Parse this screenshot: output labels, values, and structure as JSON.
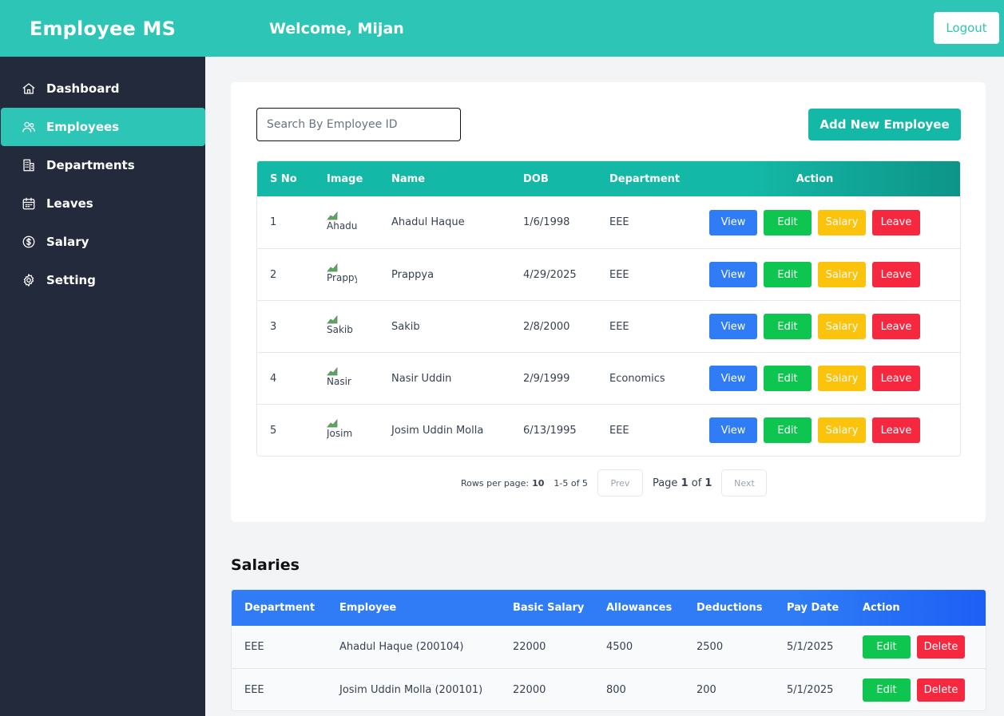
{
  "header": {
    "brand": "Employee MS",
    "welcome": "Welcome, Mijan",
    "logout_label": "Logout"
  },
  "sidebar": {
    "items": [
      {
        "label": "Dashboard",
        "icon": "home-icon"
      },
      {
        "label": "Employees",
        "icon": "users-icon",
        "active": true
      },
      {
        "label": "Departments",
        "icon": "building-icon"
      },
      {
        "label": "Leaves",
        "icon": "calendar-icon"
      },
      {
        "label": "Salary",
        "icon": "dollar-icon"
      },
      {
        "label": "Setting",
        "icon": "gear-icon"
      }
    ]
  },
  "employees": {
    "search_placeholder": "Search By Employee ID",
    "add_label": "Add New Employee",
    "columns": [
      "S No",
      "Image",
      "Name",
      "DOB",
      "Department",
      "Action"
    ],
    "actions": [
      "View",
      "Edit",
      "Salary",
      "Leave"
    ],
    "rows": [
      {
        "sno": "1",
        "img_alt": "Ahadul",
        "name": "Ahadul Haque",
        "dob": "1/6/1998",
        "dept": "EEE"
      },
      {
        "sno": "2",
        "img_alt": "Prappya",
        "name": "Prappya",
        "dob": "4/29/2025",
        "dept": "EEE"
      },
      {
        "sno": "3",
        "img_alt": "Sakib",
        "name": "Sakib",
        "dob": "2/8/2000",
        "dept": "EEE"
      },
      {
        "sno": "4",
        "img_alt": "Nasir",
        "name": "Nasir Uddin",
        "dob": "2/9/1999",
        "dept": "Economics"
      },
      {
        "sno": "5",
        "img_alt": "Josim",
        "name": "Josim Uddin Molla",
        "dob": "6/13/1995",
        "dept": "EEE"
      }
    ],
    "pagination": {
      "rows_per_page_label": "Rows per page:",
      "rows_per_page": "10",
      "range": "1-5 of 5",
      "prev": "Prev",
      "page_label": "Page",
      "page": "1",
      "of_label": "of",
      "total_pages": "1",
      "next": "Next"
    }
  },
  "salaries": {
    "title": "Salaries",
    "columns": [
      "Department",
      "Employee",
      "Basic Salary",
      "Allowances",
      "Deductions",
      "Pay Date",
      "Action"
    ],
    "edit_label": "Edit",
    "delete_label": "Delete",
    "rows": [
      {
        "dept": "EEE",
        "employee": "Ahadul Haque (200104)",
        "basic": "22000",
        "allow": "4500",
        "ded": "2500",
        "pay": "5/1/2025"
      },
      {
        "dept": "EEE",
        "employee": "Josim Uddin Molla (200101)",
        "basic": "22000",
        "allow": "800",
        "ded": "200",
        "pay": "5/1/2025"
      }
    ]
  },
  "colors": {
    "teal": "#2dc5b6",
    "sidebar": "#232a3b",
    "view": "#2f7cf6",
    "edit": "#0ec64f",
    "salary": "#fbc30c",
    "leave": "#f5283f"
  }
}
